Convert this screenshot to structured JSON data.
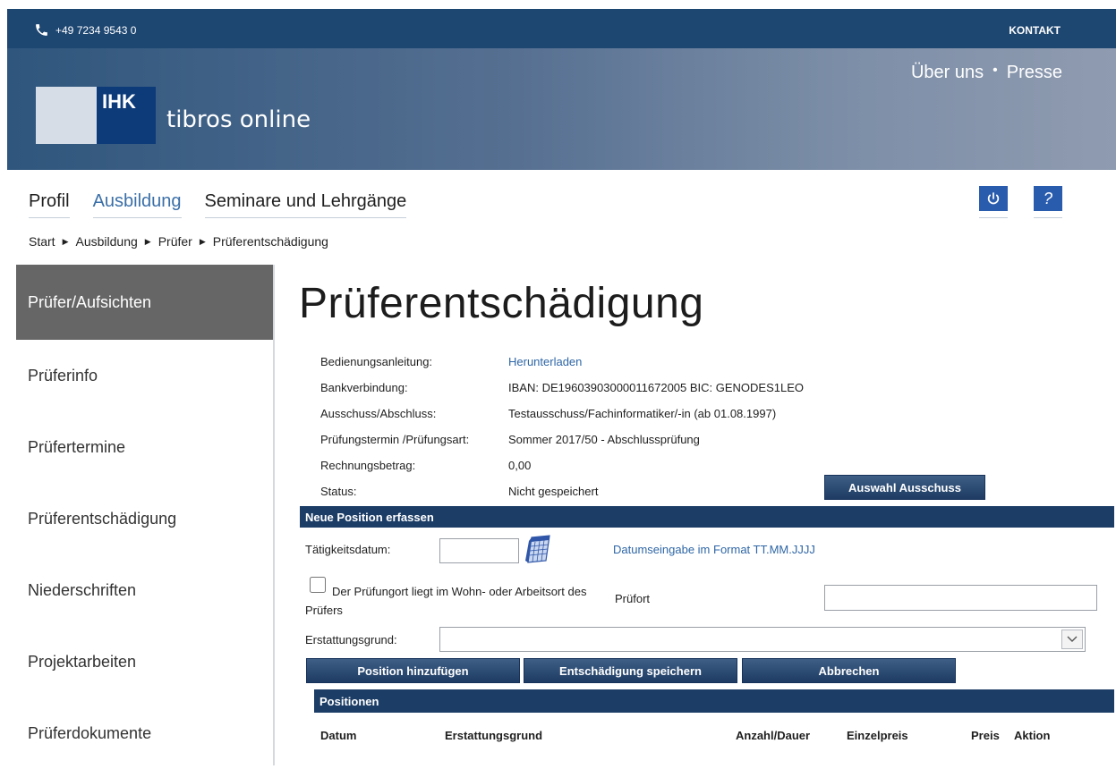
{
  "header": {
    "phone": "+49 7234 9543 0",
    "contact": "KONTAKT",
    "top_links": [
      "Über uns",
      "Presse"
    ],
    "logo_ihk": "IHK",
    "brand": "tibros online"
  },
  "nav": {
    "items": [
      "Profil",
      "Ausbildung",
      "Seminare und Lehrgänge"
    ],
    "active": "Ausbildung",
    "power_icon": "power-icon",
    "help_label": "?"
  },
  "breadcrumb": [
    "Start",
    "Ausbildung",
    "Prüfer",
    "Prüferentschädigung"
  ],
  "sidebar": {
    "items": [
      "Prüfer/Aufsichten",
      "Prüferinfo",
      "Prüfertermine",
      "Prüferentschädigung",
      "Niederschriften",
      "Projektarbeiten",
      "Prüferdokumente"
    ],
    "active": "Prüfer/Aufsichten"
  },
  "page": {
    "title": "Prüferentschädigung",
    "info": [
      {
        "label": "Bedienungsanleitung:",
        "value": "Herunterladen"
      },
      {
        "label": "Bankverbindung:",
        "value": "IBAN: DE19603903000011672005 BIC: GENODES1LEO"
      },
      {
        "label": "Ausschuss/Abschluss:",
        "value": "Testausschuss/Fachinformatiker/-in (ab 01.08.1997)"
      },
      {
        "label": "Prüfungstermin /Prüfungsart:",
        "value": "Sommer 2017/50 - Abschlussprüfung"
      },
      {
        "label": "Rechnungsbetrag:",
        "value": "0,00"
      },
      {
        "label": "Status:",
        "value": "Nicht gespeichert"
      }
    ],
    "select_committee_button": "Auswahl Ausschuss"
  },
  "new_position": {
    "section_title": "Neue Position erfassen",
    "date_label": "Tätigkeitsdatum:",
    "date_value": "",
    "date_hint": "Datumseingabe im Format TT.MM.JJJJ",
    "checkbox_label": "Der Prüfungort liegt im Wohn- oder Arbeitsort des Prüfers",
    "checkbox_checked": false,
    "place_label": "Prüfort",
    "place_value": "",
    "reason_label": "Erstattungsgrund:",
    "reason_value": "",
    "buttons": {
      "add": "Position hinzufügen",
      "save": "Entschädigung speichern",
      "cancel": "Abbrechen"
    }
  },
  "positions": {
    "section_title": "Positionen",
    "columns": [
      "Datum",
      "Erstattungsgrund",
      "Anzahl/Dauer",
      "Einzelpreis",
      "Preis",
      "Aktion"
    ]
  }
}
